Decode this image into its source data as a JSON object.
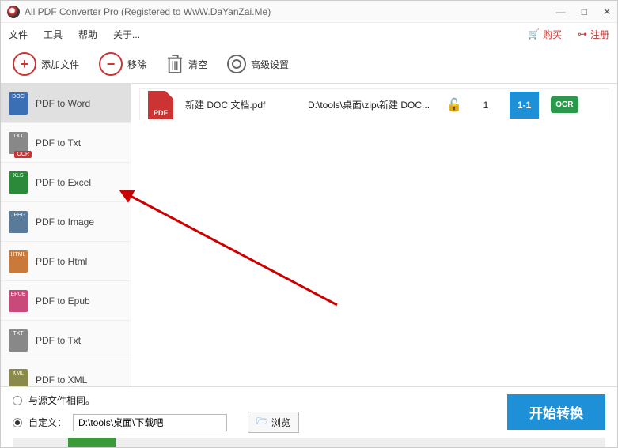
{
  "title": "All PDF Converter Pro (Registered to WwW.DaYanZai.Me)",
  "menu": {
    "file": "文件",
    "tools": "工具",
    "help": "帮助",
    "about": "关于...",
    "buy": "购买",
    "register": "注册"
  },
  "toolbar": {
    "add": "添加文件",
    "remove": "移除",
    "clear": "清空",
    "settings": "高级设置"
  },
  "sidebar": [
    {
      "label": "PDF to Word",
      "icon": "doc",
      "tag": "DOC",
      "active": true
    },
    {
      "label": "PDF to Txt",
      "icon": "txt",
      "tag": "TXT",
      "ocr": true
    },
    {
      "label": "PDF to Excel",
      "icon": "xls",
      "tag": "XLS"
    },
    {
      "label": "PDF to Image",
      "icon": "jpeg",
      "tag": "JPEG"
    },
    {
      "label": "PDF to Html",
      "icon": "html",
      "tag": "HTML"
    },
    {
      "label": "PDF to Epub",
      "icon": "epub",
      "tag": "EPUB"
    },
    {
      "label": "PDF to Txt",
      "icon": "txt",
      "tag": "TXT"
    },
    {
      "label": "PDF to XML",
      "icon": "xml",
      "tag": "XML"
    }
  ],
  "file": {
    "name": "新建 DOC 文档.pdf",
    "path": "D:\\tools\\桌面\\zip\\新建 DOC...",
    "count": "1",
    "range": "1-1",
    "ocr": "OCR"
  },
  "bottom": {
    "same_source": "与源文件相同。",
    "custom": "自定义：",
    "path": "D:\\tools\\桌面\\下载吧",
    "browse": "浏览",
    "convert": "开始转换"
  }
}
